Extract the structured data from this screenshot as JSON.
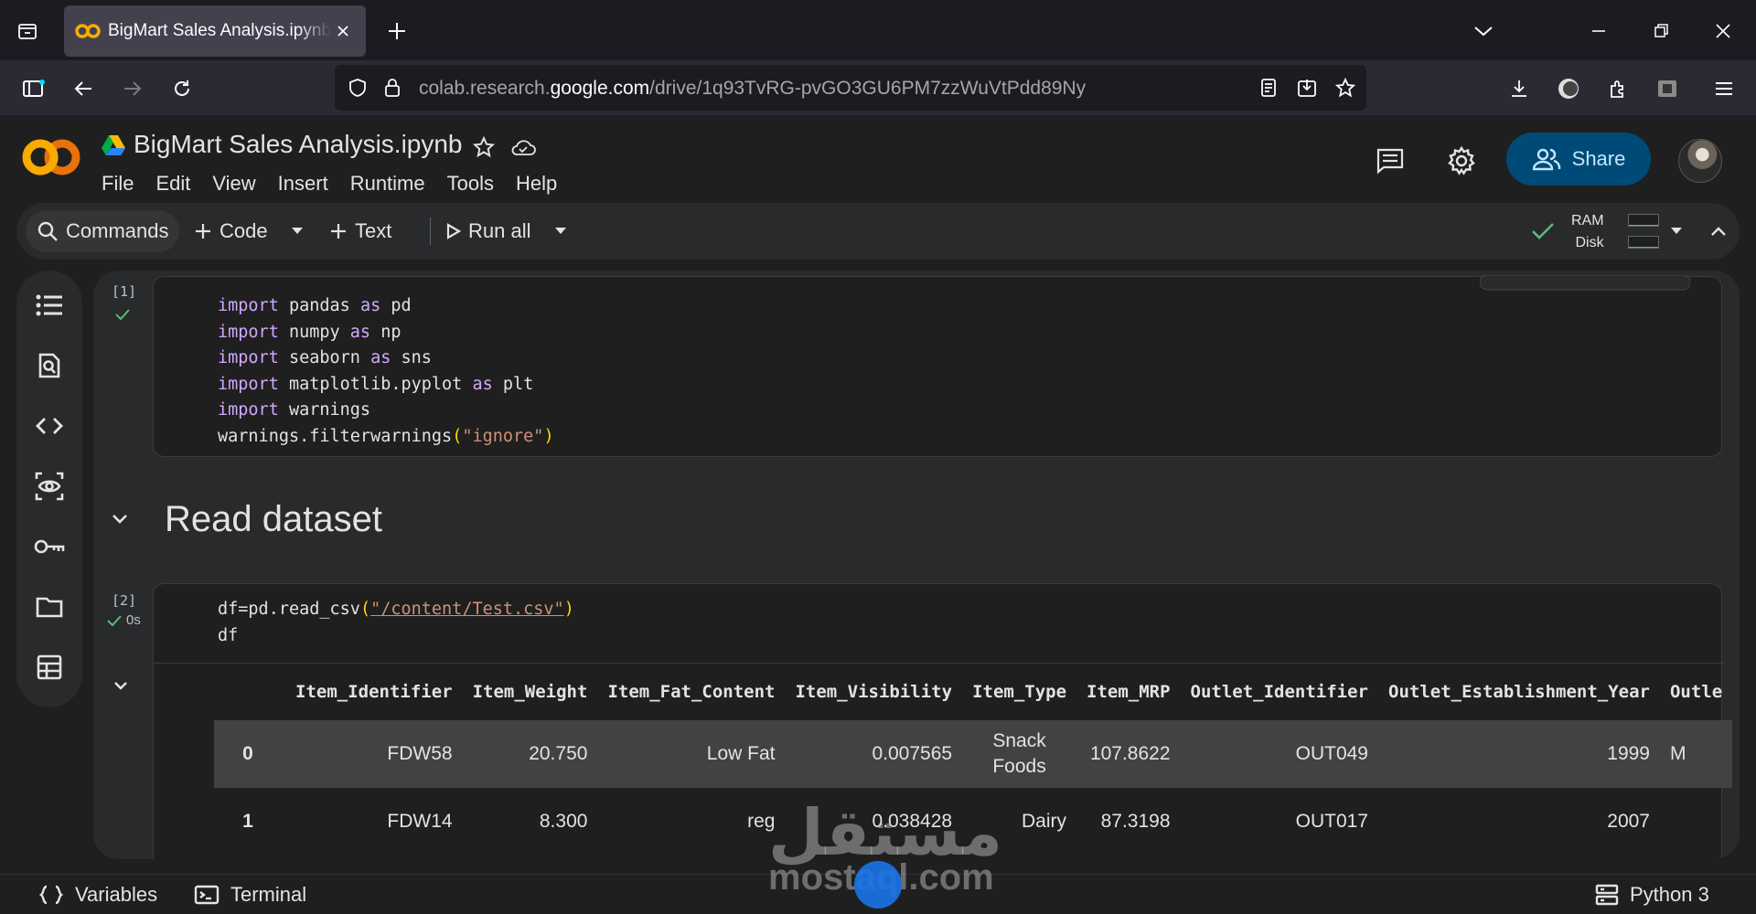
{
  "browser": {
    "tab_title": "BigMart Sales Analysis.ipynb - Colab",
    "url_prefix": "colab.research.",
    "url_host": "google.com",
    "url_path": "/drive/1q93TvRG-pvGO3GU6PM7zzWuVtPdd89Ny"
  },
  "colab": {
    "logo_text": "CO",
    "notebook_title": "BigMart Sales Analysis.ipynb",
    "menus": [
      "File",
      "Edit",
      "View",
      "Insert",
      "Runtime",
      "Tools",
      "Help"
    ],
    "share_label": "Share"
  },
  "toolbar": {
    "commands": "Commands",
    "code": "Code",
    "text": "Text",
    "run_all": "Run all",
    "ram": "RAM",
    "disk": "Disk",
    "ram_level": 0.1,
    "disk_level": 0.1
  },
  "cells": {
    "cell1": {
      "exec_count": "[1]",
      "lines": [
        {
          "kw": "import",
          "rest": " pandas ",
          "kw2": "as",
          "tail": " pd"
        },
        {
          "kw": "import",
          "rest": " numpy ",
          "kw2": "as",
          "tail": " np"
        },
        {
          "kw": "import",
          "rest": " seaborn ",
          "kw2": "as",
          "tail": " sns"
        },
        {
          "kw": "import",
          "rest": " matplotlib.pyplot ",
          "kw2": "as",
          "tail": " plt"
        },
        {
          "kw": "import",
          "rest": " warnings",
          "kw2": "",
          "tail": ""
        }
      ],
      "last_line_pre": "warnings.filterwarnings",
      "last_line_arg": "\"ignore\""
    },
    "section_title": "Read dataset",
    "cell2": {
      "exec_count": "[2]",
      "exec_time": "0s",
      "line1_pre": "df=pd.read_csv",
      "line1_arg": "\"/content/Test.csv\"",
      "line2": "df"
    }
  },
  "dataframe": {
    "columns": [
      "",
      "Item_Identifier",
      "Item_Weight",
      "Item_Fat_Content",
      "Item_Visibility",
      "Item_Type",
      "Item_MRP",
      "Outlet_Identifier",
      "Outlet_Establishment_Year",
      "Outle"
    ],
    "rows": [
      [
        "0",
        "FDW58",
        "20.750",
        "Low Fat",
        "0.007565",
        "Snack Foods",
        "107.8622",
        "OUT049",
        "1999",
        "M"
      ],
      [
        "1",
        "FDW14",
        "8.300",
        "reg",
        "0.038428",
        "Dairy",
        "87.3198",
        "OUT017",
        "2007",
        ""
      ]
    ]
  },
  "statusbar": {
    "variables": "Variables",
    "terminal": "Terminal",
    "runtime": "Python 3"
  },
  "watermark": {
    "arabic": "مستقل",
    "latin": "mostaql.com"
  }
}
